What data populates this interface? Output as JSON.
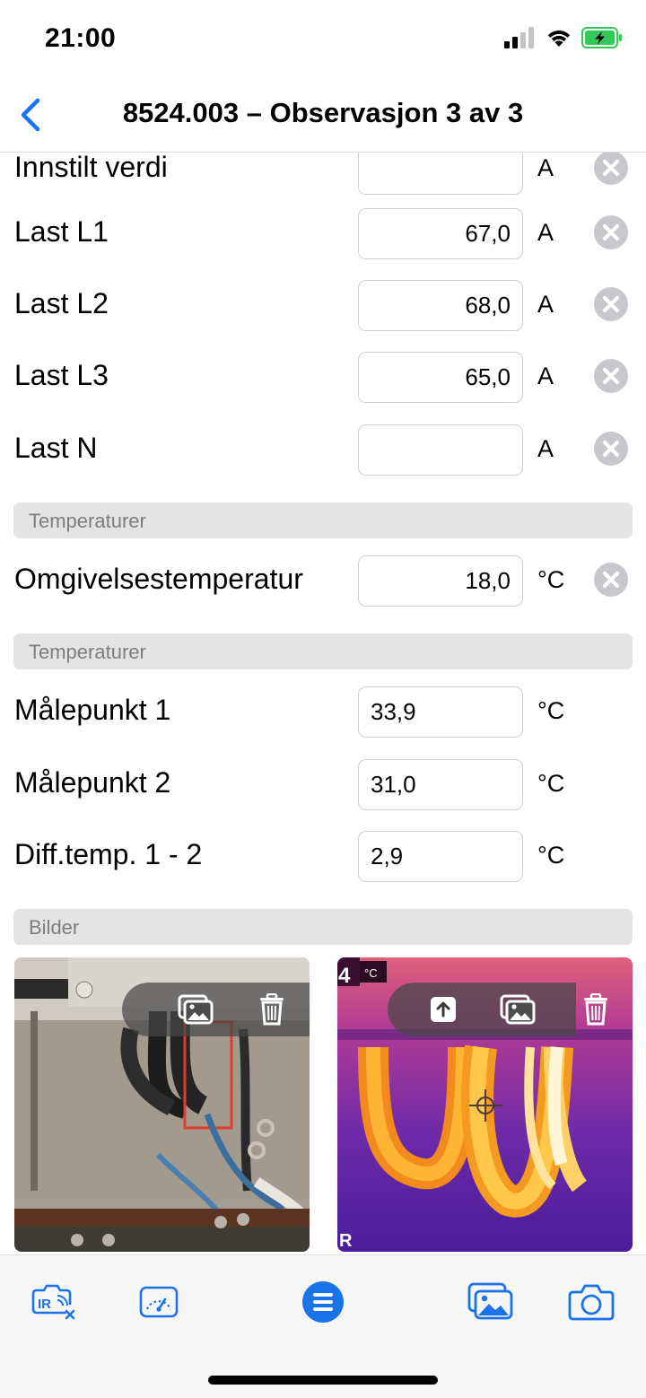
{
  "status": {
    "time": "21:00"
  },
  "nav": {
    "title": "8524.003 – Observasjon 3 av 3"
  },
  "rows_top": [
    {
      "label": "Innstilt verdi",
      "value": "",
      "unit": "A"
    },
    {
      "label": "Last L1",
      "value": "67,0",
      "unit": "A"
    },
    {
      "label": "Last L2",
      "value": "68,0",
      "unit": "A"
    },
    {
      "label": "Last L3",
      "value": "65,0",
      "unit": "A"
    },
    {
      "label": "Last N",
      "value": "",
      "unit": "A"
    }
  ],
  "section_ambient": {
    "title": "Temperaturer"
  },
  "ambient": {
    "label": "Omgivelsestemperatur",
    "value": "18,0",
    "unit": "°C"
  },
  "section_temps": {
    "title": "Temperaturer"
  },
  "temps": [
    {
      "label": "Målepunkt 1",
      "value": "33,9",
      "unit": "°C"
    },
    {
      "label": "Målepunkt 2",
      "value": "31,0",
      "unit": "°C"
    },
    {
      "label": "Diff.temp. 1 - 2",
      "value": "2,9",
      "unit": "°C"
    }
  ],
  "section_images": {
    "title": "Bilder"
  },
  "thermal_photo": {
    "range_value": "4",
    "range_unit": "°C",
    "brand_mark": "R"
  },
  "colors": {
    "accent": "#1a73e8",
    "section_bg": "#e4e4e4",
    "section_text": "#7d7d7d",
    "clear_icon": "#c7c7cc"
  }
}
